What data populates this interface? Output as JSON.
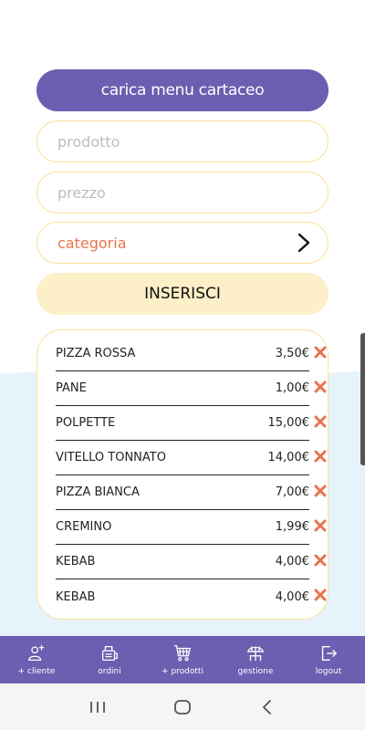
{
  "form": {
    "upload_label": "carica menu cartaceo",
    "product_placeholder": "prodotto",
    "price_placeholder": "prezzo",
    "category_label": "categoria",
    "insert_label": "INSERISCI"
  },
  "items": [
    {
      "name": "PIZZA ROSSA",
      "price": "3,50€"
    },
    {
      "name": "PANE",
      "price": "1,00€"
    },
    {
      "name": "POLPETTE",
      "price": "15,00€"
    },
    {
      "name": "VITELLO TONNATO",
      "price": "14,00€"
    },
    {
      "name": "PIZZA BIANCA",
      "price": "7,00€"
    },
    {
      "name": "CREMINO",
      "price": "1,99€"
    },
    {
      "name": "KEBAB",
      "price": "4,00€"
    },
    {
      "name": "KEBAB",
      "price": "4,00€"
    }
  ],
  "nav": [
    {
      "label": "+ cliente",
      "icon": "add-user-icon"
    },
    {
      "label": "ordini",
      "icon": "orders-icon"
    },
    {
      "label": "+ prodotti",
      "icon": "cart-icon"
    },
    {
      "label": "gestione",
      "icon": "table-umbrella-icon"
    },
    {
      "label": "logout",
      "icon": "logout-icon"
    }
  ],
  "colors": {
    "primary": "#6a5fb0",
    "field_border": "#fbe29a",
    "insert_bg": "#fdefc7",
    "accent": "#e8734a",
    "background_wave": "#e7f3fa"
  }
}
